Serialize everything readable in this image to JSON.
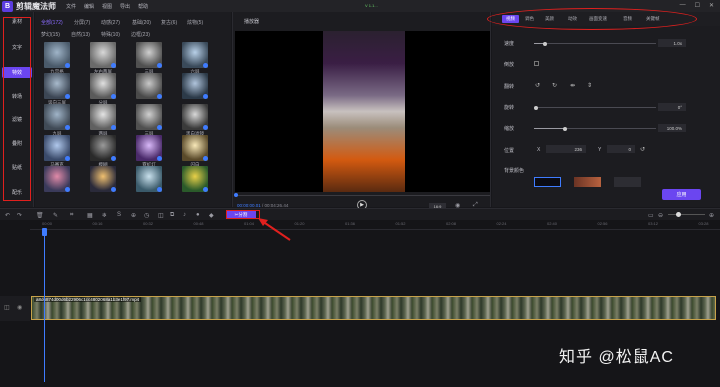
{
  "app": {
    "name": "剪辑魔法师",
    "logo_letter": "B",
    "version": "V 1.1..."
  },
  "menu": [
    "文件",
    "编辑",
    "视图",
    "导出",
    "帮助"
  ],
  "window_controls": [
    "—",
    "☐",
    "✕"
  ],
  "nav": {
    "items": [
      {
        "label": "素材",
        "active": false
      },
      {
        "label": "文字",
        "active": false
      },
      {
        "label": "特效",
        "active": true
      },
      {
        "label": "转场",
        "active": false
      },
      {
        "label": "滤镜",
        "active": false
      },
      {
        "label": "叠附",
        "active": false
      },
      {
        "label": "贴纸",
        "active": false
      },
      {
        "label": "配乐",
        "active": false
      }
    ]
  },
  "library": {
    "tabs_row1": [
      "全部(172)",
      "分屏(7)",
      "动感(27)",
      "基础(20)",
      "复古(6)",
      "炫物(5)"
    ],
    "tabs_row2": [
      "梦幻(15)",
      "自然(13)",
      "特殊(10)",
      "边框(23)"
    ],
    "thumbs": [
      {
        "label": "九宫格"
      },
      {
        "label": "左右两屏"
      },
      {
        "label": "三屏"
      },
      {
        "label": "六屏"
      },
      {
        "label": "竖向三屏"
      },
      {
        "label": "分屏"
      },
      {
        "label": ""
      },
      {
        "label": ""
      },
      {
        "label": "九屏"
      },
      {
        "label": "两屏"
      },
      {
        "label": "三屏"
      },
      {
        "label": "黑白滤镜"
      },
      {
        "label": "马赛克"
      },
      {
        "label": "模糊"
      },
      {
        "label": "霓虹灯"
      },
      {
        "label": "闪白"
      },
      {
        "label": ""
      },
      {
        "label": ""
      },
      {
        "label": ""
      },
      {
        "label": ""
      }
    ]
  },
  "preview": {
    "title": "播放器",
    "current_time": "00:00:00.01",
    "total_time": "00:04:26.44",
    "ratio": "16:9"
  },
  "props": {
    "tabs": [
      {
        "label": "视频",
        "active": true
      },
      {
        "label": "调色",
        "active": false
      },
      {
        "label": "美颜",
        "active": false
      },
      {
        "label": "动效",
        "active": false
      },
      {
        "label": "画面变速",
        "active": false
      },
      {
        "label": "音频",
        "active": false
      },
      {
        "label": "关键帧",
        "active": false
      }
    ],
    "speed_label": "速度",
    "speed_value": "1.0x",
    "reverse_label": "倒放",
    "flip_label": "翻转",
    "rotate_label": "旋转",
    "rotate_value": "0°",
    "scale_label": "缩放",
    "scale_value": "100.0%",
    "position_label": "位置",
    "pos_x_label": "X",
    "pos_x_value": "236",
    "pos_y_label": "Y",
    "pos_y_value": "0",
    "bg_label": "背景颜色",
    "confirm_label": "应用",
    "colors": {
      "swatch1": "#0b0b12",
      "swatch2": "#a4553a",
      "swatch3": "#2d2d33"
    }
  },
  "toolbar": {
    "split_label": "分割"
  },
  "timeline": {
    "marks": [
      "00:00",
      "00:16",
      "00:32",
      "00:48",
      "01:04",
      "01:20",
      "01:36",
      "01:52",
      "02:08",
      "02:24",
      "02:40",
      "02:56",
      "03:12",
      "03:28"
    ],
    "clip_name": "a8d6874d00d6b22906c1cc4802068a1b3e1f97.mp4"
  },
  "watermark": "知乎 @松鼠AC"
}
